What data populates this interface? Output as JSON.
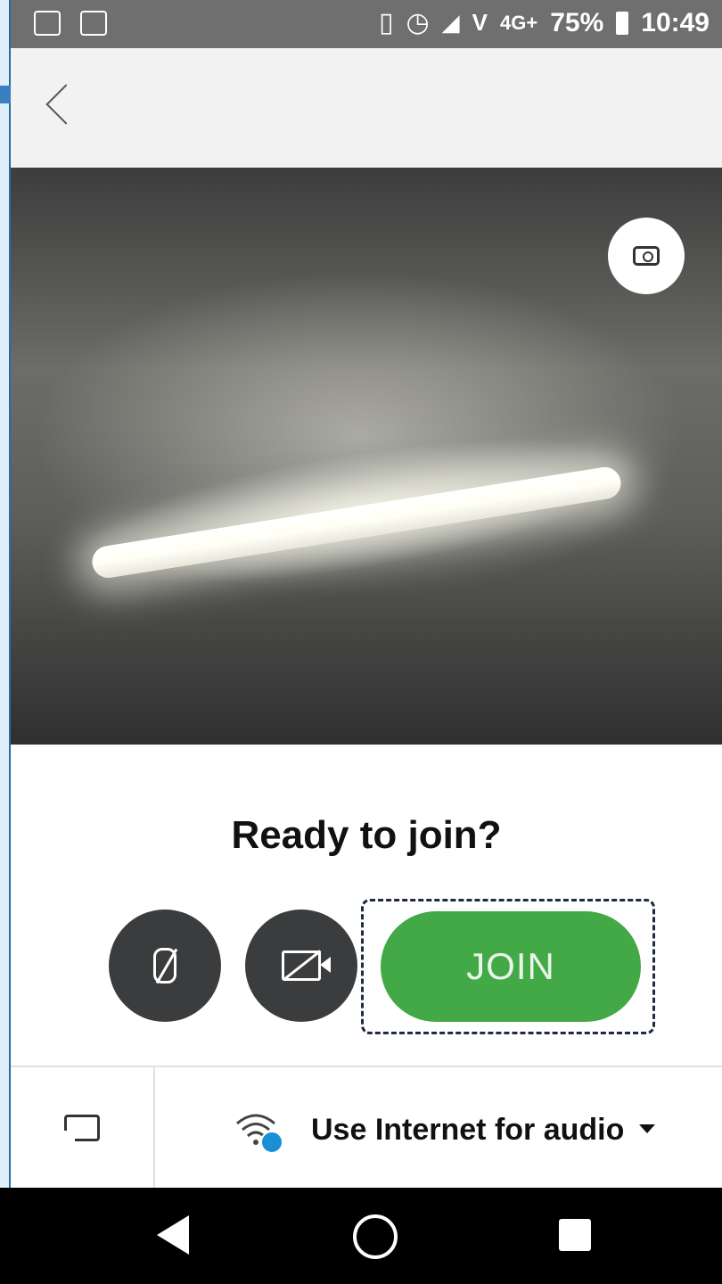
{
  "status_bar": {
    "battery": "75%",
    "time": "10:49",
    "network": "4G+",
    "icons": [
      "gallery-icon",
      "activity-icon",
      "vibrate-icon",
      "alarm-icon",
      "signal-icon",
      "volte-icon",
      "lte-icon"
    ]
  },
  "header": {
    "back_icon": "chevron-left-icon"
  },
  "preview": {
    "flip_camera_icon": "flip-camera-icon"
  },
  "join": {
    "title": "Ready to join?",
    "mic_icon": "mic-off-icon",
    "camera_icon": "video-off-icon",
    "join_label": "JOIN",
    "join_color": "#43a846"
  },
  "audio": {
    "cast_icon": "cast-icon",
    "wifi_icon": "wifi-icon",
    "label": "Use Internet for audio",
    "dropdown_icon": "caret-down-icon"
  },
  "nav": {
    "back": "nav-back-icon",
    "home": "nav-home-icon",
    "recent": "nav-recents-icon"
  }
}
